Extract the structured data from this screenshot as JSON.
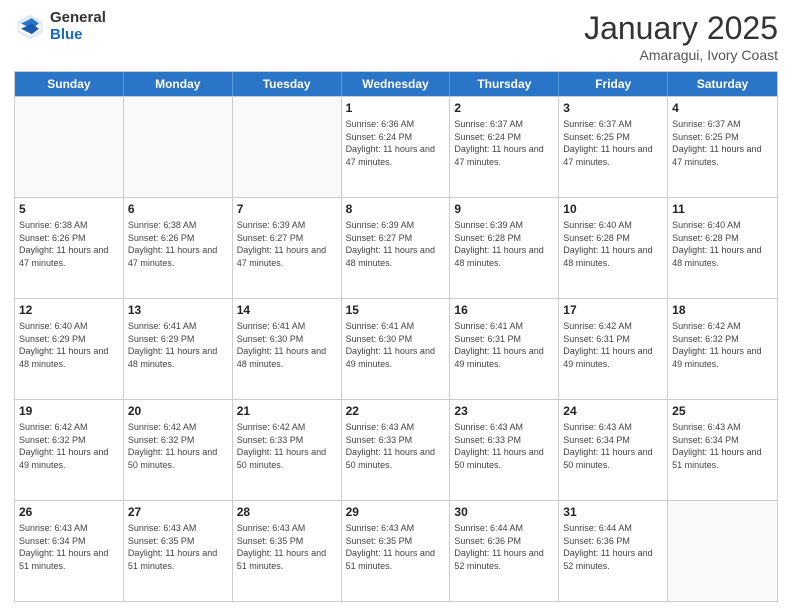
{
  "logo": {
    "general": "General",
    "blue": "Blue"
  },
  "title": {
    "month": "January 2025",
    "location": "Amaragui, Ivory Coast"
  },
  "header_days": [
    "Sunday",
    "Monday",
    "Tuesday",
    "Wednesday",
    "Thursday",
    "Friday",
    "Saturday"
  ],
  "weeks": [
    [
      {
        "day": "",
        "sunrise": "",
        "sunset": "",
        "daylight": ""
      },
      {
        "day": "",
        "sunrise": "",
        "sunset": "",
        "daylight": ""
      },
      {
        "day": "",
        "sunrise": "",
        "sunset": "",
        "daylight": ""
      },
      {
        "day": "1",
        "sunrise": "Sunrise: 6:36 AM",
        "sunset": "Sunset: 6:24 PM",
        "daylight": "Daylight: 11 hours and 47 minutes."
      },
      {
        "day": "2",
        "sunrise": "Sunrise: 6:37 AM",
        "sunset": "Sunset: 6:24 PM",
        "daylight": "Daylight: 11 hours and 47 minutes."
      },
      {
        "day": "3",
        "sunrise": "Sunrise: 6:37 AM",
        "sunset": "Sunset: 6:25 PM",
        "daylight": "Daylight: 11 hours and 47 minutes."
      },
      {
        "day": "4",
        "sunrise": "Sunrise: 6:37 AM",
        "sunset": "Sunset: 6:25 PM",
        "daylight": "Daylight: 11 hours and 47 minutes."
      }
    ],
    [
      {
        "day": "5",
        "sunrise": "Sunrise: 6:38 AM",
        "sunset": "Sunset: 6:26 PM",
        "daylight": "Daylight: 11 hours and 47 minutes."
      },
      {
        "day": "6",
        "sunrise": "Sunrise: 6:38 AM",
        "sunset": "Sunset: 6:26 PM",
        "daylight": "Daylight: 11 hours and 47 minutes."
      },
      {
        "day": "7",
        "sunrise": "Sunrise: 6:39 AM",
        "sunset": "Sunset: 6:27 PM",
        "daylight": "Daylight: 11 hours and 47 minutes."
      },
      {
        "day": "8",
        "sunrise": "Sunrise: 6:39 AM",
        "sunset": "Sunset: 6:27 PM",
        "daylight": "Daylight: 11 hours and 48 minutes."
      },
      {
        "day": "9",
        "sunrise": "Sunrise: 6:39 AM",
        "sunset": "Sunset: 6:28 PM",
        "daylight": "Daylight: 11 hours and 48 minutes."
      },
      {
        "day": "10",
        "sunrise": "Sunrise: 6:40 AM",
        "sunset": "Sunset: 6:28 PM",
        "daylight": "Daylight: 11 hours and 48 minutes."
      },
      {
        "day": "11",
        "sunrise": "Sunrise: 6:40 AM",
        "sunset": "Sunset: 6:28 PM",
        "daylight": "Daylight: 11 hours and 48 minutes."
      }
    ],
    [
      {
        "day": "12",
        "sunrise": "Sunrise: 6:40 AM",
        "sunset": "Sunset: 6:29 PM",
        "daylight": "Daylight: 11 hours and 48 minutes."
      },
      {
        "day": "13",
        "sunrise": "Sunrise: 6:41 AM",
        "sunset": "Sunset: 6:29 PM",
        "daylight": "Daylight: 11 hours and 48 minutes."
      },
      {
        "day": "14",
        "sunrise": "Sunrise: 6:41 AM",
        "sunset": "Sunset: 6:30 PM",
        "daylight": "Daylight: 11 hours and 48 minutes."
      },
      {
        "day": "15",
        "sunrise": "Sunrise: 6:41 AM",
        "sunset": "Sunset: 6:30 PM",
        "daylight": "Daylight: 11 hours and 49 minutes."
      },
      {
        "day": "16",
        "sunrise": "Sunrise: 6:41 AM",
        "sunset": "Sunset: 6:31 PM",
        "daylight": "Daylight: 11 hours and 49 minutes."
      },
      {
        "day": "17",
        "sunrise": "Sunrise: 6:42 AM",
        "sunset": "Sunset: 6:31 PM",
        "daylight": "Daylight: 11 hours and 49 minutes."
      },
      {
        "day": "18",
        "sunrise": "Sunrise: 6:42 AM",
        "sunset": "Sunset: 6:32 PM",
        "daylight": "Daylight: 11 hours and 49 minutes."
      }
    ],
    [
      {
        "day": "19",
        "sunrise": "Sunrise: 6:42 AM",
        "sunset": "Sunset: 6:32 PM",
        "daylight": "Daylight: 11 hours and 49 minutes."
      },
      {
        "day": "20",
        "sunrise": "Sunrise: 6:42 AM",
        "sunset": "Sunset: 6:32 PM",
        "daylight": "Daylight: 11 hours and 50 minutes."
      },
      {
        "day": "21",
        "sunrise": "Sunrise: 6:42 AM",
        "sunset": "Sunset: 6:33 PM",
        "daylight": "Daylight: 11 hours and 50 minutes."
      },
      {
        "day": "22",
        "sunrise": "Sunrise: 6:43 AM",
        "sunset": "Sunset: 6:33 PM",
        "daylight": "Daylight: 11 hours and 50 minutes."
      },
      {
        "day": "23",
        "sunrise": "Sunrise: 6:43 AM",
        "sunset": "Sunset: 6:33 PM",
        "daylight": "Daylight: 11 hours and 50 minutes."
      },
      {
        "day": "24",
        "sunrise": "Sunrise: 6:43 AM",
        "sunset": "Sunset: 6:34 PM",
        "daylight": "Daylight: 11 hours and 50 minutes."
      },
      {
        "day": "25",
        "sunrise": "Sunrise: 6:43 AM",
        "sunset": "Sunset: 6:34 PM",
        "daylight": "Daylight: 11 hours and 51 minutes."
      }
    ],
    [
      {
        "day": "26",
        "sunrise": "Sunrise: 6:43 AM",
        "sunset": "Sunset: 6:34 PM",
        "daylight": "Daylight: 11 hours and 51 minutes."
      },
      {
        "day": "27",
        "sunrise": "Sunrise: 6:43 AM",
        "sunset": "Sunset: 6:35 PM",
        "daylight": "Daylight: 11 hours and 51 minutes."
      },
      {
        "day": "28",
        "sunrise": "Sunrise: 6:43 AM",
        "sunset": "Sunset: 6:35 PM",
        "daylight": "Daylight: 11 hours and 51 minutes."
      },
      {
        "day": "29",
        "sunrise": "Sunrise: 6:43 AM",
        "sunset": "Sunset: 6:35 PM",
        "daylight": "Daylight: 11 hours and 51 minutes."
      },
      {
        "day": "30",
        "sunrise": "Sunrise: 6:44 AM",
        "sunset": "Sunset: 6:36 PM",
        "daylight": "Daylight: 11 hours and 52 minutes."
      },
      {
        "day": "31",
        "sunrise": "Sunrise: 6:44 AM",
        "sunset": "Sunset: 6:36 PM",
        "daylight": "Daylight: 11 hours and 52 minutes."
      },
      {
        "day": "",
        "sunrise": "",
        "sunset": "",
        "daylight": ""
      }
    ]
  ]
}
